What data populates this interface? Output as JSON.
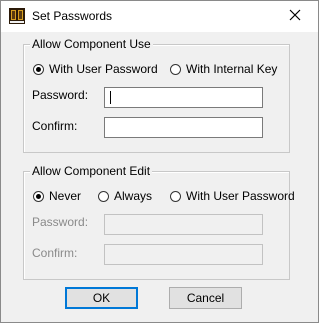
{
  "window": {
    "title": "Set Passwords",
    "app_icon": "dbase-app-icon",
    "close_icon": "close-icon"
  },
  "use_group": {
    "title": "Allow Component Use",
    "options": [
      {
        "label": "With User Password",
        "selected": true
      },
      {
        "label": "With Internal Key",
        "selected": false
      }
    ],
    "password_label": "Password:",
    "password_value": "",
    "confirm_label": "Confirm:",
    "confirm_value": ""
  },
  "edit_group": {
    "title": "Allow Component Edit",
    "options": [
      {
        "label": "Never",
        "selected": true
      },
      {
        "label": "Always",
        "selected": false
      },
      {
        "label": "With User Password",
        "selected": false
      }
    ],
    "password_label": "Password:",
    "password_value": "",
    "confirm_label": "Confirm:",
    "confirm_value": ""
  },
  "buttons": {
    "ok": "OK",
    "cancel": "Cancel"
  },
  "colors": {
    "focus": "#0078d7",
    "disabled_text": "#8a8a8a"
  }
}
